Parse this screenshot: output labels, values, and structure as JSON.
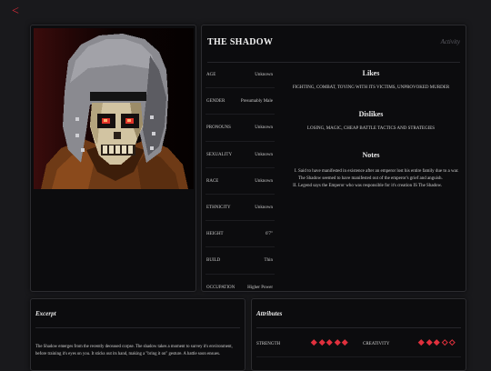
{
  "nav": {
    "back": "<"
  },
  "character": {
    "name": "THE SHADOW",
    "activity": "Activity",
    "facts": [
      {
        "key": "AGE",
        "value": "Unknown"
      },
      {
        "key": "GENDER",
        "value": "Presumably Male"
      },
      {
        "key": "PRONOUNS",
        "value": "Unknown"
      },
      {
        "key": "SEXUALITY",
        "value": "Unknown"
      },
      {
        "key": "RACE",
        "value": "Unknown"
      },
      {
        "key": "ETHNICITY",
        "value": "Unknown"
      },
      {
        "key": "HEIGHT",
        "value": "6'7\""
      },
      {
        "key": "BUILD",
        "value": "Thin"
      },
      {
        "key": "OCCUPATION",
        "value": "Higher Power"
      }
    ]
  },
  "likes": {
    "title": "Likes",
    "text": "FIGHTING, COMBAT, TOYING WITH ITS VICTIMS, UNPROVOKED MURDER"
  },
  "dislikes": {
    "title": "Dislikes",
    "text": "LOSING, MAGIC, CHEAP BATTLE TACTICS AND STRATEGIES"
  },
  "notes": {
    "title": "Notes",
    "items": [
      "Said to have manifested in existence after an emperor lost his entire family due to a war. The Shadow seemed to have manifested out of the emperor's grief and anguish.",
      "Legend says the Emperor who was responsible for it's creation IS The Shadow."
    ]
  },
  "excerpt": {
    "title": "Excerpt",
    "text": "The Shadow emerges from the recently deceased corpse. The shadow takes a moment to survey it's environment, before training it's eyes on you. It sticks out its hand, making a \"bring it on\" gesture. A battle soon ensues."
  },
  "attributes": {
    "title": "Attributes",
    "items": [
      {
        "name": "STRENGTH",
        "value": 5,
        "max": 5
      },
      {
        "name": "CREATIVITY",
        "value": 3,
        "max": 5
      }
    ]
  },
  "colors": {
    "accent": "#e0303d",
    "background": "#19191c",
    "panel": "#0c0c0e"
  }
}
